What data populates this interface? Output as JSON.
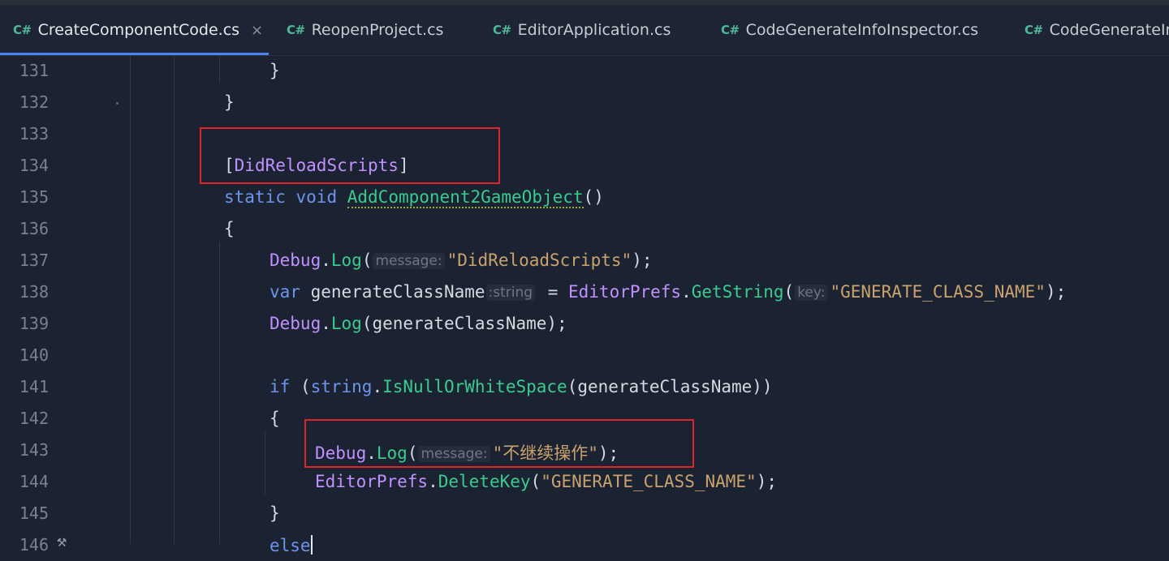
{
  "tabs": [
    {
      "icon": "C#",
      "label": "CreateComponentCode.cs",
      "active": true,
      "close": "×"
    },
    {
      "icon": "C#",
      "label": "ReopenProject.cs"
    },
    {
      "icon": "C#",
      "label": "EditorApplication.cs"
    },
    {
      "icon": "C#",
      "label": "CodeGenerateInfoInspector.cs"
    },
    {
      "icon": "C#",
      "label": "CodeGenerateIn"
    }
  ],
  "line_numbers": [
    "131",
    "132",
    "133",
    "134",
    "135",
    "136",
    "137",
    "138",
    "139",
    "140",
    "141",
    "142",
    "143",
    "144",
    "145",
    "146"
  ],
  "code": {
    "l131": "}",
    "l132": "}",
    "l134_open": "[",
    "l134_attr": "DidReloadScripts",
    "l134_close": "]",
    "l135_kw1": "static",
    "l135_kw2": "void",
    "l135_name": "AddComponent2GameObject",
    "l135_parens": "()",
    "l136": "{",
    "l137_cls": "Debug",
    "l137_meth": "Log",
    "l137_hint": "message:",
    "l137_str": "\"DidReloadScripts\"",
    "l138_kw": "var",
    "l138_var": "generateClassName",
    "l138_hint": ":string",
    "l138_eq": " = ",
    "l138_cls": "EditorPrefs",
    "l138_meth": "GetString",
    "l138_hint2": "key:",
    "l138_str": "\"GENERATE_CLASS_NAME\"",
    "l139_cls": "Debug",
    "l139_meth": "Log",
    "l139_arg": "generateClassName",
    "l141_kw": "if",
    "l141_type": "string",
    "l141_meth": "IsNullOrWhiteSpace",
    "l141_arg": "generateClassName",
    "l142": "{",
    "l143_cls": "Debug",
    "l143_meth": "Log",
    "l143_hint": "message:",
    "l143_str": "\"不继续操作\"",
    "l144_cls": "EditorPrefs",
    "l144_meth": "DeleteKey",
    "l144_str": "\"GENERATE_CLASS_NAME\"",
    "l145": "}",
    "l146_kw": "else"
  },
  "icons": {
    "gutter": "hammer-icon"
  },
  "colors": {
    "keyword": "#6c95eb",
    "class": "#c191ff",
    "method": "#39cc8f",
    "string": "#c9a26d",
    "highlight_box": "#e0242c",
    "active_tab_underline": "#4c84f0"
  }
}
